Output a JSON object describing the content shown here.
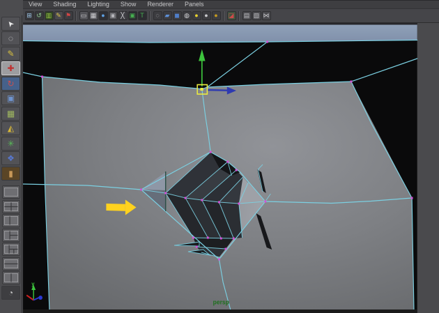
{
  "menu_bar": {
    "items": [
      "View",
      "Shading",
      "Lighting",
      "Show",
      "Renderer",
      "Panels"
    ]
  },
  "panel_toolbar": {
    "icons": [
      {
        "name": "pan-zoom-camera-icon",
        "glyph": "⊞",
        "color": "#9fc7e8",
        "bg": "#37373b"
      },
      {
        "name": "camera-tumble-icon",
        "glyph": "↺",
        "color": "#8fd08f",
        "bg": "#37373b"
      },
      {
        "name": "image-plane-icon",
        "glyph": "▥",
        "color": "#9ccb45",
        "bg": "#314425"
      },
      {
        "name": "grease-pencil-icon",
        "glyph": "✎",
        "color": "#e0c84a",
        "bg": "#4a4a4e"
      },
      {
        "name": "pin-marker-icon",
        "glyph": "⚑",
        "color": "#d04545",
        "bg": "#3c3c40"
      },
      {
        "sep": true
      },
      {
        "name": "film-gate-icon",
        "glyph": "▭",
        "color": "#cfcfd2",
        "bg": "#55555a"
      },
      {
        "name": "resolution-gate-icon",
        "glyph": "▦",
        "color": "#cfcfd2",
        "bg": "#55555a"
      },
      {
        "name": "gate-mask-icon",
        "glyph": "●",
        "color": "#5d9fe0",
        "bg": "#2e2e33"
      },
      {
        "name": "field-chart-icon",
        "glyph": "▣",
        "color": "#b5b5ba",
        "bg": "#47474b"
      },
      {
        "name": "safe-action-icon",
        "glyph": "╳",
        "color": "#d8d8dc",
        "bg": "#3f3f44"
      },
      {
        "name": "safe-title-icon",
        "glyph": "▣",
        "color": "#46b050",
        "bg": "#2c2c31"
      },
      {
        "name": "frame-title-icon",
        "glyph": "T",
        "color": "#46b050",
        "bg": "#2c2c31"
      },
      {
        "sep": true
      },
      {
        "name": "wireframe-display-icon",
        "glyph": "◌",
        "color": "#c9c9cd",
        "bg": "#3c3c40"
      },
      {
        "name": "flat-shade-icon",
        "glyph": "▰",
        "color": "#5d8fd6",
        "bg": "#3c3c40"
      },
      {
        "name": "smooth-shade-icon",
        "glyph": "◼",
        "color": "#4f7ec9",
        "bg": "#3c3c40"
      },
      {
        "name": "textured-display-icon",
        "glyph": "◍",
        "color": "#d3d3d6",
        "bg": "#3c3c40"
      },
      {
        "name": "use-all-lights-icon",
        "glyph": "●",
        "color": "#e8d22e",
        "bg": "#3c3c40"
      },
      {
        "name": "shadows-icon",
        "glyph": "●",
        "color": "#c9c9cc",
        "bg": "#3c3c40"
      },
      {
        "name": "occlusion-icon",
        "glyph": "●",
        "color": "#c49a1f",
        "bg": "#3c3c40"
      },
      {
        "sep": true
      },
      {
        "name": "isolate-select-icon",
        "glyph": "◪",
        "color": "#cc4b4b",
        "bg": "#3f5540"
      },
      {
        "sep": true
      },
      {
        "name": "xray-display-icon",
        "glyph": "▤",
        "color": "#bfbfc3",
        "bg": "#4a4a4e"
      },
      {
        "name": "backface-display-icon",
        "glyph": "▧",
        "color": "#bfbfc3",
        "bg": "#4a4a4e"
      },
      {
        "name": "connections-icon",
        "glyph": "⋈",
        "color": "#c9c9cd",
        "bg": "#4a4a4e"
      }
    ]
  },
  "toolbox": {
    "tools": [
      {
        "name": "select-tool",
        "glyph": "➤",
        "color": "#e8e8e8",
        "bg": "#525256",
        "rot": true,
        "active": false
      },
      {
        "name": "lasso-select-tool",
        "glyph": "◌",
        "color": "#dedee0",
        "bg": "#525256",
        "rot": false,
        "active": false
      },
      {
        "name": "paint-select-tool",
        "glyph": "✎",
        "color": "#d8c040",
        "bg": "#525256",
        "rot": false,
        "active": false
      },
      {
        "name": "move-tool",
        "glyph": "✚",
        "color": "#c02f2f",
        "bg": "#9d9da0",
        "rot": false,
        "active": true
      },
      {
        "name": "rotate-tool",
        "glyph": "↻",
        "color": "#c85050",
        "bg": "#46618a",
        "rot": false,
        "active": false
      },
      {
        "name": "scale-tool",
        "glyph": "▣",
        "color": "#6f95d0",
        "bg": "#525256",
        "rot": false,
        "active": false
      },
      {
        "name": "universal-manipulator-tool",
        "glyph": "▦",
        "color": "#a0b860",
        "bg": "#525256",
        "rot": false,
        "active": false
      },
      {
        "name": "soft-modification-tool",
        "glyph": "◭",
        "color": "#d8b838",
        "bg": "#525256",
        "rot": false,
        "active": false
      },
      {
        "name": "show-manipulator-tool",
        "glyph": "✳",
        "color": "#58b858",
        "bg": "#525256",
        "rot": false,
        "active": false
      },
      {
        "name": "last-tool-used",
        "glyph": "❖",
        "color": "#5878d0",
        "bg": "#525256",
        "rot": false,
        "active": false
      },
      {
        "name": "sculpt-tool",
        "glyph": "▮",
        "color": "#c89858",
        "bg": "#5a4526",
        "rot": false,
        "active": false
      }
    ],
    "layouts": [
      {
        "name": "layout-single-pane",
        "lines": []
      },
      {
        "name": "layout-four-pane",
        "lines": [
          [
            0.5,
            0,
            0.5,
            1
          ],
          [
            0,
            0.5,
            1,
            0.5
          ]
        ]
      },
      {
        "name": "layout-two-pane-side",
        "lines": [
          [
            0.4,
            0,
            0.4,
            1
          ]
        ]
      },
      {
        "name": "layout-three-pane-right",
        "lines": [
          [
            0.4,
            0,
            0.4,
            1
          ],
          [
            0.4,
            0.5,
            1,
            0.5
          ]
        ]
      },
      {
        "name": "layout-outliner-persp",
        "lines": [
          [
            0.35,
            0,
            0.35,
            1
          ],
          [
            0.35,
            0.5,
            1,
            0.5
          ],
          [
            0.7,
            0.5,
            0.7,
            1
          ]
        ]
      },
      {
        "name": "layout-two-pane-stacked",
        "lines": [
          [
            0,
            0.5,
            1,
            0.5
          ]
        ]
      },
      {
        "name": "layout-hypergraph-persp",
        "lines": [
          [
            0.5,
            0,
            0.5,
            1
          ]
        ]
      }
    ],
    "footer_icon": {
      "name": "paint-effects-icon",
      "glyph": "◔",
      "color": "#cccccc"
    }
  },
  "viewport": {
    "camera_label": "persp",
    "axis_y_label": "y"
  },
  "colors": {
    "wireframe_cyan": "#7bd0e2",
    "vertex_magenta": "#d54fd6",
    "selected_yellow": "#ecec3e",
    "manip_y_green": "#3dc43d",
    "manip_x_blue": "#2e3ab0",
    "annotation_yellow": "#ffd21e",
    "band_slate": "#8799b3",
    "face_gray": "#818388",
    "hole_dark": "#2b2e33",
    "background_black": "#0a0a0b",
    "persp_green": "#1d701d",
    "axis_red": "#cc2020",
    "axis_blue": "#2a39d4"
  }
}
